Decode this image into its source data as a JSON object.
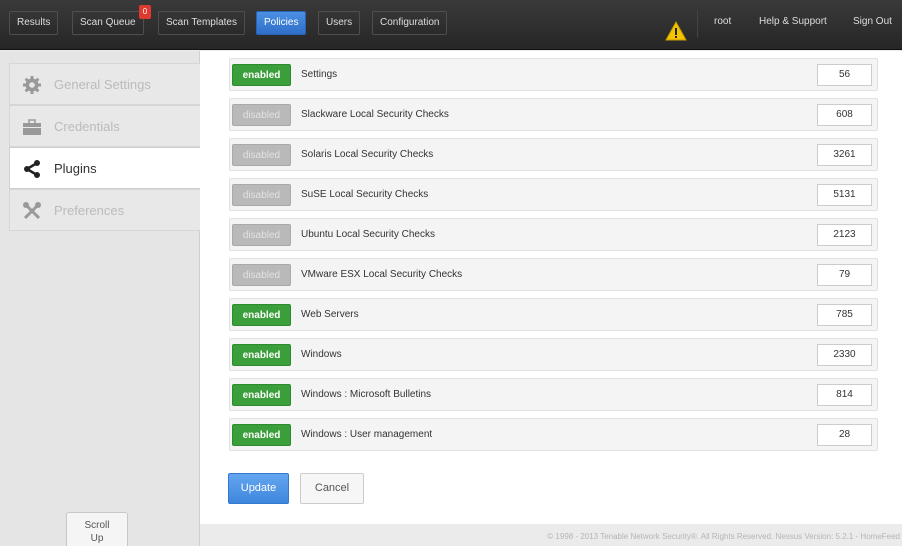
{
  "nav": {
    "results": "Results",
    "scan_queue": "Scan Queue",
    "scan_queue_badge": "0",
    "scan_templates": "Scan Templates",
    "policies": "Policies",
    "users": "Users",
    "configuration": "Configuration",
    "user": "root",
    "help": "Help & Support",
    "signout": "Sign Out"
  },
  "sidebar": {
    "items": [
      {
        "label": "General Settings",
        "icon": "gear-icon"
      },
      {
        "label": "Credentials",
        "icon": "briefcase-icon"
      },
      {
        "label": "Plugins",
        "icon": "share-icon"
      },
      {
        "label": "Preferences",
        "icon": "tools-icon"
      }
    ],
    "active": "Plugins",
    "scroll_up_line1": "Scroll",
    "scroll_up_line2": "Up"
  },
  "plugins": {
    "enabled_label": "enabled",
    "disabled_label": "disabled",
    "families": [
      {
        "status": "enabled",
        "name": "Settings",
        "count": "56"
      },
      {
        "status": "disabled",
        "name": "Slackware Local Security Checks",
        "count": "608"
      },
      {
        "status": "disabled",
        "name": "Solaris Local Security Checks",
        "count": "3261"
      },
      {
        "status": "disabled",
        "name": "SuSE Local Security Checks",
        "count": "5131"
      },
      {
        "status": "disabled",
        "name": "Ubuntu Local Security Checks",
        "count": "2123"
      },
      {
        "status": "disabled",
        "name": "VMware ESX Local Security Checks",
        "count": "79"
      },
      {
        "status": "enabled",
        "name": "Web Servers",
        "count": "785"
      },
      {
        "status": "enabled",
        "name": "Windows",
        "count": "2330"
      },
      {
        "status": "enabled",
        "name": "Windows : Microsoft Bulletins",
        "count": "814"
      },
      {
        "status": "enabled",
        "name": "Windows : User management",
        "count": "28"
      }
    ]
  },
  "actions": {
    "update": "Update",
    "cancel": "Cancel"
  },
  "footer": "© 1998 - 2013 Tenable Network Security®. All Rights Reserved. Nessus Version: 5.2.1 - HomeFeed",
  "colors": {
    "enabled": "#3a9e3a",
    "disabled": "#b9b9b9",
    "active_nav": "#3e86dd",
    "badge": "#e0392f",
    "warning": "#f5c400"
  }
}
